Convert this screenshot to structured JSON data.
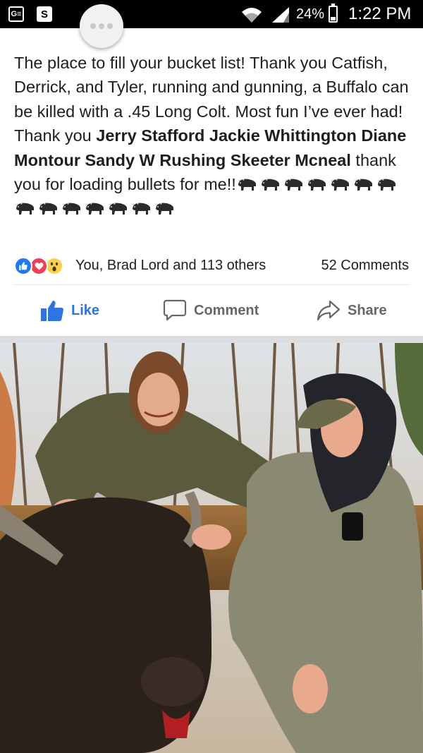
{
  "status_bar": {
    "left_icons": [
      "G≡",
      "S"
    ],
    "battery_percent": "24%",
    "time": "1:22 PM"
  },
  "chat_head": {
    "icon": "chat-bubble-icon"
  },
  "post": {
    "text_intro": "The place to fill your bucket list! Thank you Catfish, Derrick, and Tyler, running and gunning, a Buffalo can be killed with a .45 Long Colt. Most fun I’ve ever had! Thank you ",
    "text_bold_names": "Jerry Stafford Jackie Whittington Diane Montour Sandy W Rushing Skeeter Mcneal",
    "text_outro": " thank you for loading bullets for me!!",
    "emoji_name": "water-buffalo-emoji",
    "emoji_count": 14
  },
  "reactions": {
    "icons": [
      "like-reaction-icon",
      "love-reaction-icon",
      "wow-reaction-icon"
    ],
    "summary": "You, Brad Lord and 113 others",
    "comments": "52 Comments"
  },
  "actions": {
    "like": "Like",
    "comment": "Comment",
    "share": "Share"
  },
  "colors": {
    "like_blue": "#2f74e5",
    "text": "#1c1e21",
    "muted": "#65676b",
    "love_red": "#f33e58",
    "wow_yellow": "#fcd148"
  },
  "photo": {
    "description_label": "post-photo"
  }
}
